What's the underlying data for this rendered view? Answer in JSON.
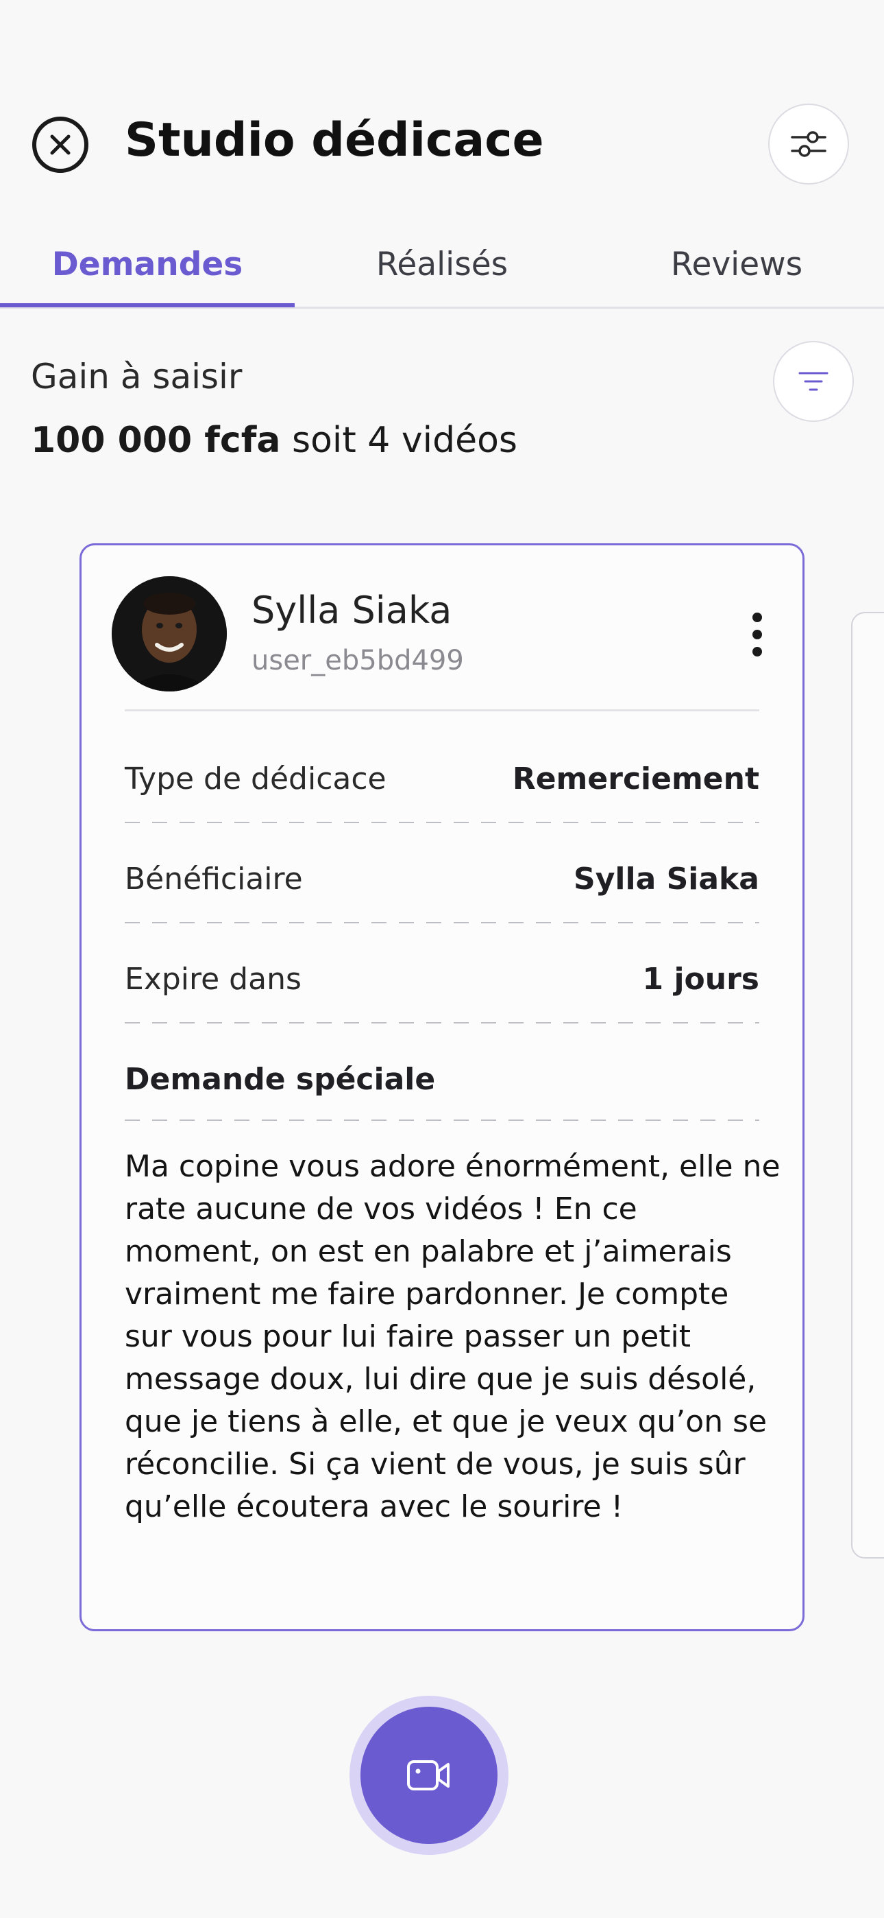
{
  "header": {
    "title": "Studio dédicace",
    "close_icon": "close-circle-icon",
    "settings_icon": "sliders-icon"
  },
  "tabs": [
    {
      "label": "Demandes",
      "active": true
    },
    {
      "label": "Réalisés",
      "active": false
    },
    {
      "label": "Reviews",
      "active": false
    }
  ],
  "gain": {
    "label": "Gain à saisir",
    "amount": "100 000 fcfa",
    "suffix": " soit 4 vidéos",
    "filter_icon": "filter-lines-icon"
  },
  "card": {
    "user_name": "Sylla Siaka",
    "user_handle": "user_eb5bd499",
    "rows": [
      {
        "label": "Type de dédicace",
        "value": "Remerciement"
      },
      {
        "label": "Bénéficiaire",
        "value": "Sylla Siaka"
      },
      {
        "label": "Expire dans",
        "value": "1 jours"
      }
    ],
    "special_title": "Demande spéciale",
    "special_text": "Ma copine vous adore énormément, elle ne rate aucune de vos vidéos ! En ce moment, on est en palabre et j’aimerais vraiment me faire pardonner. Je compte sur vous pour lui faire passer un petit message doux, lui dire que je suis désolé, que je tiens à elle, et que je veux qu’on se réconcilie. Si ça vient de vous, je suis sûr qu’elle écoutera avec le sourire !"
  },
  "colors": {
    "accent": "#6b5bd0",
    "card_border": "#7b6bd8"
  },
  "record_icon": "video-camera-icon"
}
